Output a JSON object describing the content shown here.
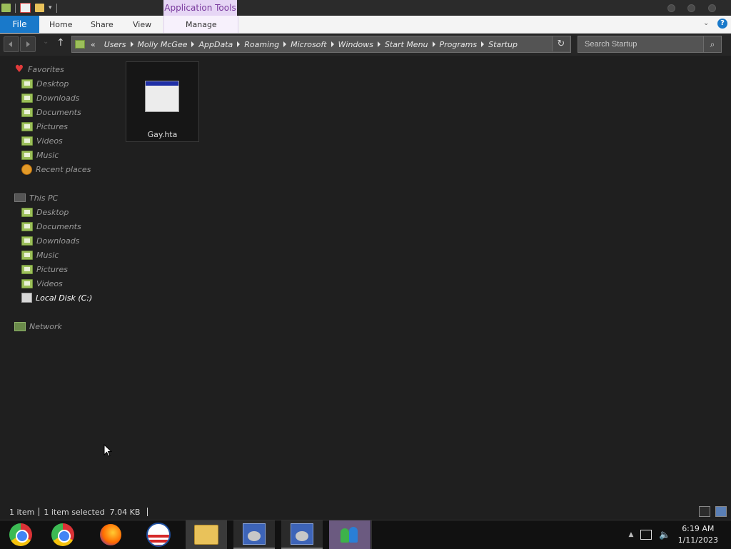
{
  "ribbon": {
    "context_group": "Application Tools",
    "tabs": [
      "File",
      "Home",
      "Share",
      "View",
      "Manage"
    ]
  },
  "address": {
    "prefix": "«",
    "breadcrumbs": [
      "Users",
      "Molly McGee",
      "AppData",
      "Roaming",
      "Microsoft",
      "Windows",
      "Start Menu",
      "Programs",
      "Startup"
    ]
  },
  "search": {
    "placeholder": "Search Startup"
  },
  "nav": {
    "favorites": {
      "label": "Favorites",
      "items": [
        "Desktop",
        "Downloads",
        "Documents",
        "Pictures",
        "Videos",
        "Music",
        "Recent places"
      ]
    },
    "this_pc": {
      "label": "This PC",
      "items": [
        "Desktop",
        "Documents",
        "Downloads",
        "Music",
        "Pictures",
        "Videos",
        "Local Disk (C:)"
      ]
    },
    "network": {
      "label": "Network"
    }
  },
  "files": [
    {
      "name": "Gay.hta",
      "icon": "hta-application-icon"
    }
  ],
  "status": {
    "count": "1 item",
    "selected": "1 item selected",
    "size": "7.04 KB"
  },
  "taskbar": {
    "apps": [
      "chrome-icon",
      "chrome-icon",
      "firefox-icon",
      "obama-logo-icon",
      "file-explorer-icon",
      "setup-icon",
      "setup-icon",
      "msn-messenger-icon"
    ],
    "time": "6:19 AM",
    "date": "1/11/2023"
  },
  "colors": {
    "file_tab": "#1979ca",
    "context_tab_bg": "#e6d6f5",
    "context_tab_text": "#7a3a9e",
    "background": "#1f1f1f"
  }
}
